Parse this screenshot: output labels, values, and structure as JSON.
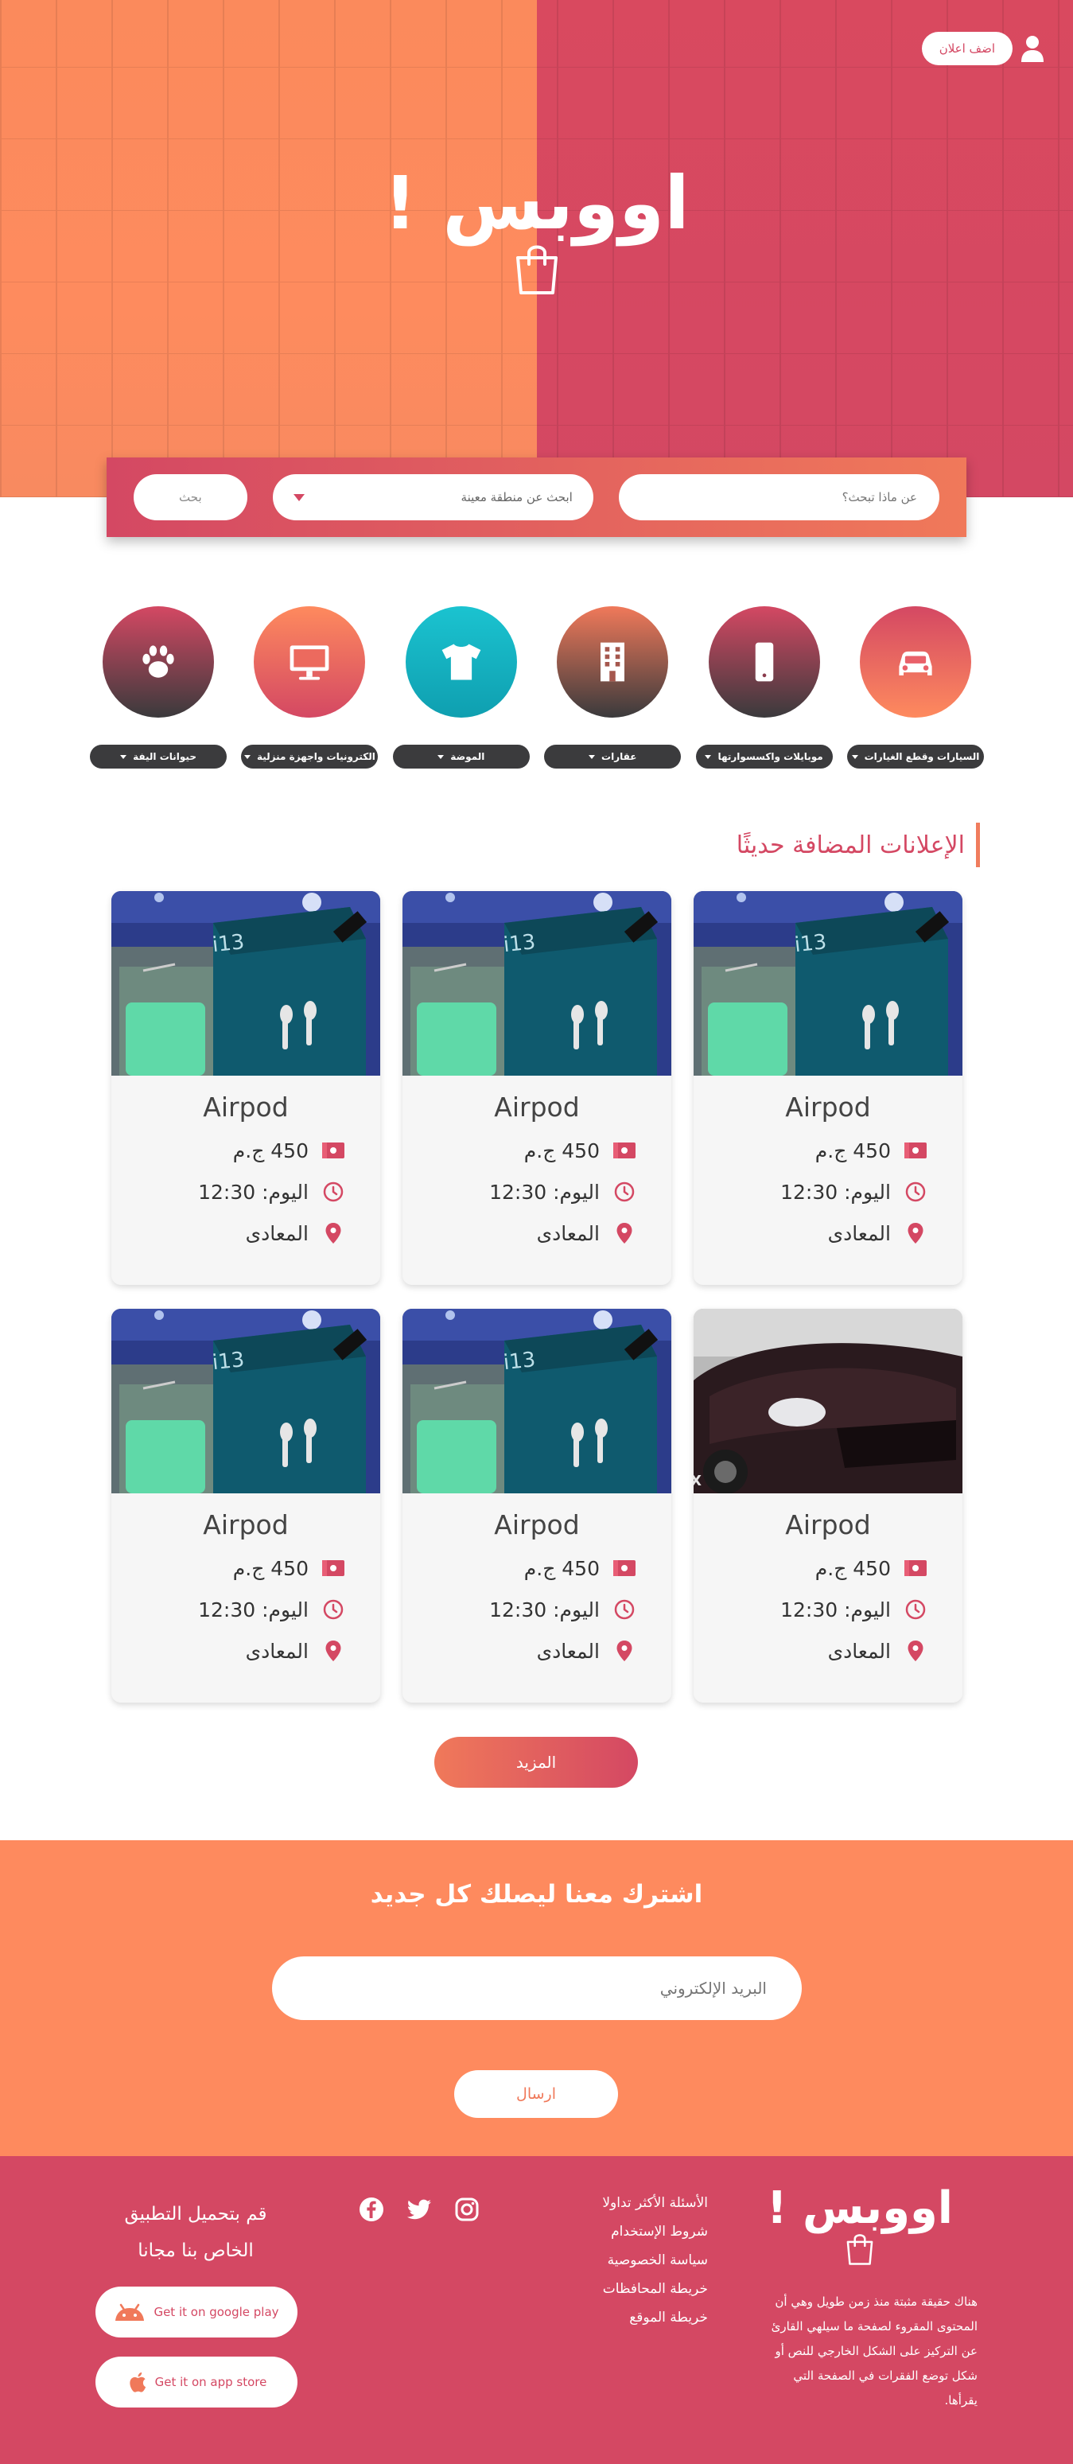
{
  "header": {
    "logo": "اووبس !",
    "add_ad_label": "اضف اعلان"
  },
  "search": {
    "query_placeholder": "عن ماذا تبحث؟",
    "region_placeholder": "ابحث عن منطقة معينة",
    "button_label": "بحث"
  },
  "categories": [
    {
      "label": "السيارات وقطع الغيارات",
      "icon": "car-icon",
      "color_from": "#d44863",
      "color_to": "#fe8a5e"
    },
    {
      "label": "موبايلات واكسسوارتها",
      "icon": "mobile-icon",
      "color_from": "#3a3a3c",
      "color_to": "#d44863"
    },
    {
      "label": "عقارات",
      "icon": "building-icon",
      "color_from": "#f0795a",
      "color_to": "#3a3a3c"
    },
    {
      "label": "الموضة",
      "icon": "tshirt-icon",
      "color_from": "#1bc3d0",
      "color_to": "#10a3b5"
    },
    {
      "label": "الكترونيات واجهزة منزلية",
      "icon": "monitor-icon",
      "color_from": "#fe8a5e",
      "color_to": "#d44863"
    },
    {
      "label": "حيوانات اليفة",
      "icon": "paw-icon",
      "color_from": "#d44863",
      "color_to": "#3a3a3c"
    }
  ],
  "section_title": "الإعلانات المضافة حديثًا",
  "cards": [
    {
      "title": "Airpod",
      "price": "450 ج.م",
      "time": "اليوم: 12:30",
      "location": "المعادى",
      "image": "airpods-box"
    },
    {
      "title": "Airpod",
      "price": "450 ج.م",
      "time": "اليوم: 12:30",
      "location": "المعادى",
      "image": "airpods-box"
    },
    {
      "title": "Airpod",
      "price": "450 ج.م",
      "time": "اليوم: 12:30",
      "location": "المعادى",
      "image": "airpods-box"
    },
    {
      "title": "Airpod",
      "price": "450 ج.م",
      "time": "اليوم: 12:30",
      "location": "المعادى",
      "image": "car-photo"
    },
    {
      "title": "Airpod",
      "price": "450 ج.م",
      "time": "اليوم: 12:30",
      "location": "المعادى",
      "image": "airpods-box"
    },
    {
      "title": "Airpod",
      "price": "450 ج.م",
      "time": "اليوم: 12:30",
      "location": "المعادى",
      "image": "airpods-box"
    }
  ],
  "more_label": "المزيد",
  "newsletter": {
    "title": "اشترك معنا ليصلك كل جديد",
    "email_placeholder": "البريد الإلكتروني",
    "submit_label": "ارسال"
  },
  "footer": {
    "logo": "اووبس !",
    "about": "هناك حقيقة مثبتة منذ زمن طويل وهي أن المحتوى المقروء لصفحة ما سيلهي القارئ عن التركيز على الشكل الخارجي للنص أو شكل توضع الفقرات في الصفحة التي يقرأها.",
    "links": [
      "الأسئلة الأكثر تداولا",
      "شروط الإستخدام",
      "سياسة الخصوصية",
      "خريطة المحافظات",
      "خريطة الموقع"
    ],
    "social": [
      "instagram-icon",
      "twitter-icon",
      "facebook-icon"
    ],
    "app_text_line1": "قم بتحميل التطبيق",
    "app_text_line2": "الخاص بنا مجانا",
    "google_play_label": "Get it on google play",
    "app_store_label": "Get it on app store"
  },
  "colors": {
    "primary": "#d44863",
    "secondary": "#fe8a5e",
    "dark": "#3a3a3c",
    "teal": "#1bc3d0"
  }
}
